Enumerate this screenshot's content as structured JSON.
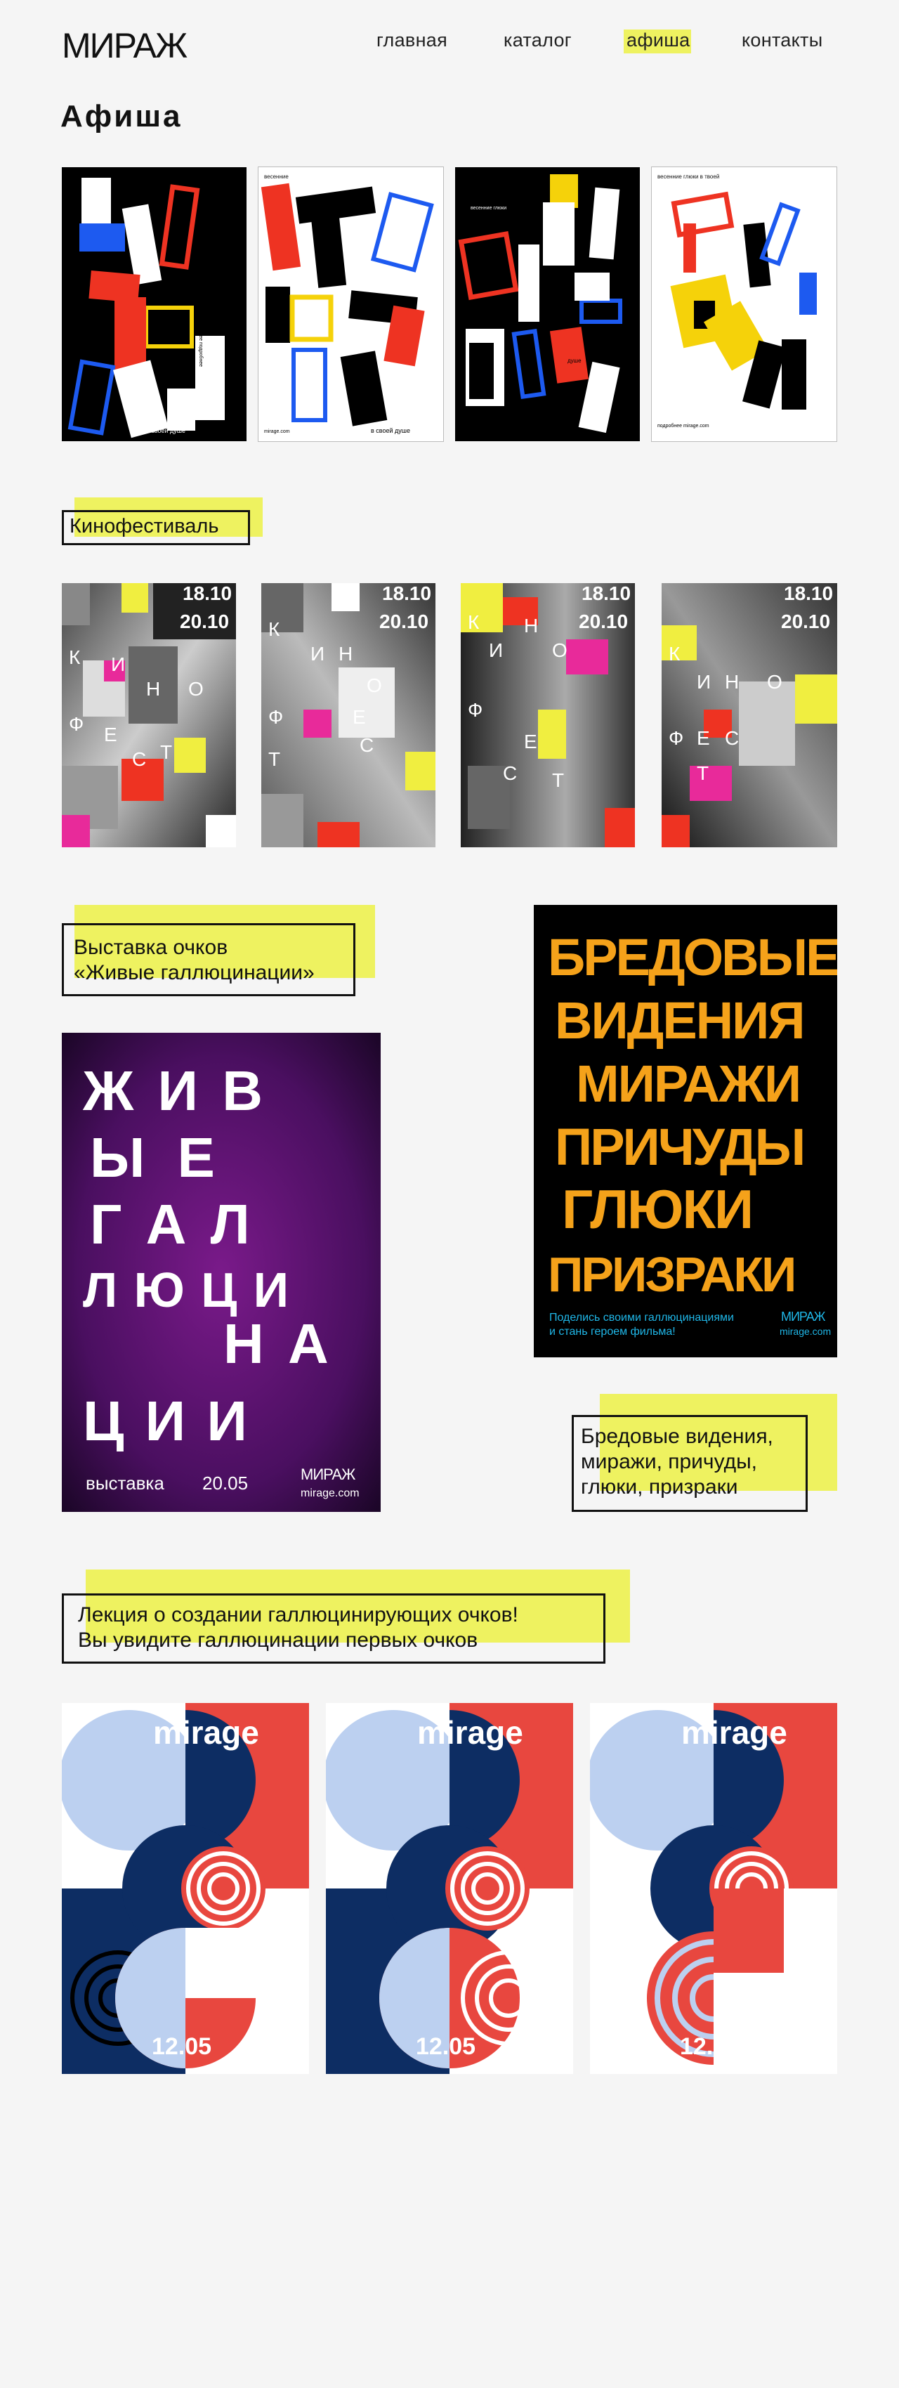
{
  "header": {
    "logo_text": "МИРАЖ",
    "nav": [
      {
        "label": "главная"
      },
      {
        "label": "каталог"
      },
      {
        "label": "афиша",
        "active": true
      },
      {
        "label": "контакты"
      }
    ]
  },
  "page_title": "Афиша",
  "section1": {
    "posters": [
      {
        "tagline": "в своей душе",
        "caption": "подробнее подробнее"
      },
      {
        "header_small": "весенние",
        "tagline": "в своей душе",
        "footer_small": "mirage.com"
      },
      {
        "header_small": "весенние глюки",
        "tagline": "душе",
        "footer_small": "mirage.com"
      },
      {
        "header_small": "весенние глюки в твоей",
        "footer_small": "подробнее mirage.com"
      }
    ]
  },
  "section2": {
    "label": "Кинофестиваль",
    "date1": "18.10",
    "date2": "20.10",
    "letters": [
      "К",
      "И",
      "Н",
      "О",
      "Ф",
      "Е",
      "С",
      "Т"
    ]
  },
  "section3": {
    "label_line1": "Выставка очков",
    "label_line2": "«Живые галлюцинации»",
    "poster_left": {
      "word_lines": [
        "Ж И В",
        "Ы Е",
        "Г А Л",
        "Л Ю Ц И",
        "Н А",
        "Ц И И"
      ],
      "bottom_left": "выставка",
      "bottom_date": "20.05",
      "logo": "МИРАЖ",
      "site": "mirage.com"
    },
    "poster_right": {
      "word_lines": [
        "БРЕДОВЫЕ",
        "ВИДЕНИЯ",
        "МИРАЖИ",
        "ПРИЧУДЫ",
        "ГЛЮКИ",
        "ПРИЗРАКИ"
      ],
      "bottom_text_1": "Поделись своими галлюцинациями",
      "bottom_text_2": "и стань героем фильма!",
      "logo": "МИРАЖ",
      "site": "mirage.com"
    },
    "label2_line1": "Бредовые видения,",
    "label2_line2": "миражи, причуды,",
    "label2_line3": "глюки, призраки"
  },
  "section4": {
    "label_line1": "Лекция о создании галлюцинирующих очков!",
    "label_line2": "Вы увидите галлюцинации первых очков",
    "brand": "mirage",
    "date": "12.05"
  },
  "colors": {
    "accent_yellow": "#eef260",
    "poster_red": "#e8473f",
    "poster_navy": "#0d2d63",
    "poster_light_blue": "#bcd0f0",
    "orange": "#f5a21a"
  }
}
